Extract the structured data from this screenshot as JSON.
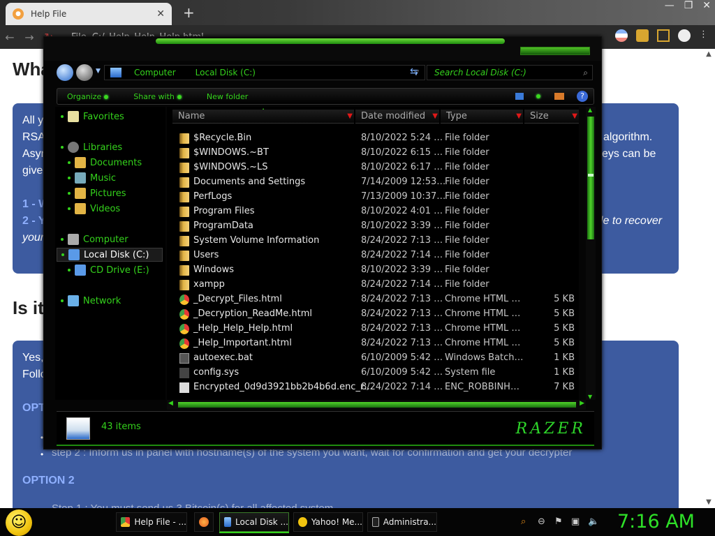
{
  "browser": {
    "tab_title": "Help File",
    "tab_close": "✕",
    "new_tab": "+",
    "window_controls": [
      "—",
      "❐",
      "✕"
    ],
    "url_prefix": "File",
    "url": "C:/_Help_Help_Help.html"
  },
  "page": {
    "heading1": "Wha",
    "heading2": "Is it",
    "box1_lines": [
      "All y",
      "RSA",
      "Asyr",
      "give"
    ],
    "box1_right": [
      " algorithm.",
      "eys can be"
    ],
    "box1_items": [
      "1 - W",
      "2 - Y"
    ],
    "box1_italic_right": "le to recover",
    "box1_italic_left": "your",
    "box2_lines": [
      "Yes,",
      "Follo"
    ],
    "option1": "OPTI",
    "step2_text": "step 2 : Inform us in panel with hostname(s) of the system you want, wait for confirmation and get your decrypter",
    "option2": "OPTION 2",
    "step1_text": "Step 1 : You must send us 3 Bitcoin(s) for all affected system"
  },
  "explorer": {
    "address": [
      "Computer",
      "Local Disk (C:)"
    ],
    "search_placeholder": "Search Local Disk (C:)",
    "commands": [
      "Organize",
      "Share with",
      "New folder"
    ],
    "nav": [
      {
        "label": "Favorites",
        "indent": 0,
        "icon": "star-icon"
      },
      {
        "label": "Libraries",
        "indent": 0,
        "icon": "libraries-icon"
      },
      {
        "label": "Documents",
        "indent": 1,
        "icon": "documents-icon"
      },
      {
        "label": "Music",
        "indent": 1,
        "icon": "music-icon"
      },
      {
        "label": "Pictures",
        "indent": 1,
        "icon": "pictures-icon"
      },
      {
        "label": "Videos",
        "indent": 1,
        "icon": "videos-icon"
      },
      {
        "label": "Computer",
        "indent": 0,
        "icon": "computer-icon"
      },
      {
        "label": "Local Disk (C:)",
        "indent": 1,
        "icon": "drive-icon",
        "selected": true
      },
      {
        "label": "CD Drive (E:)",
        "indent": 1,
        "icon": "cd-drive-icon"
      },
      {
        "label": "Network",
        "indent": 0,
        "icon": "network-icon"
      }
    ],
    "columns": [
      "Name",
      "Date modified",
      "Type",
      "Size"
    ],
    "files": [
      {
        "name": "$Recycle.Bin",
        "date": "8/10/2022 5:24 …",
        "type": "File folder",
        "size": "",
        "icon": "folder"
      },
      {
        "name": "$WINDOWS.~BT",
        "date": "8/10/2022 6:15 …",
        "type": "File folder",
        "size": "",
        "icon": "folder"
      },
      {
        "name": "$WINDOWS.~LS",
        "date": "8/10/2022 6:17 …",
        "type": "File folder",
        "size": "",
        "icon": "folder"
      },
      {
        "name": "Documents and Settings",
        "date": "7/14/2009 12:53…",
        "type": "File folder",
        "size": "",
        "icon": "folder"
      },
      {
        "name": "PerfLogs",
        "date": "7/13/2009 10:37…",
        "type": "File folder",
        "size": "",
        "icon": "folder"
      },
      {
        "name": "Program Files",
        "date": "8/10/2022 4:01 …",
        "type": "File folder",
        "size": "",
        "icon": "folder"
      },
      {
        "name": "ProgramData",
        "date": "8/10/2022 3:39 …",
        "type": "File folder",
        "size": "",
        "icon": "folder"
      },
      {
        "name": "System Volume Information",
        "date": "8/24/2022 7:13 …",
        "type": "File folder",
        "size": "",
        "icon": "folder"
      },
      {
        "name": "Users",
        "date": "8/24/2022 7:14 …",
        "type": "File folder",
        "size": "",
        "icon": "folder"
      },
      {
        "name": "Windows",
        "date": "8/10/2022 3:39 …",
        "type": "File folder",
        "size": "",
        "icon": "folder"
      },
      {
        "name": "xampp",
        "date": "8/24/2022 7:14 …",
        "type": "File folder",
        "size": "",
        "icon": "folder"
      },
      {
        "name": "_Decrypt_Files.html",
        "date": "8/24/2022 7:13 …",
        "type": "Chrome HTML …",
        "size": "5 KB",
        "icon": "chrome"
      },
      {
        "name": "_Decryption_ReadMe.html",
        "date": "8/24/2022 7:13 …",
        "type": "Chrome HTML …",
        "size": "5 KB",
        "icon": "chrome"
      },
      {
        "name": "_Help_Help_Help.html",
        "date": "8/24/2022 7:13 …",
        "type": "Chrome HTML …",
        "size": "5 KB",
        "icon": "chrome"
      },
      {
        "name": "_Help_Important.html",
        "date": "8/24/2022 7:13 …",
        "type": "Chrome HTML …",
        "size": "5 KB",
        "icon": "chrome"
      },
      {
        "name": "autoexec.bat",
        "date": "6/10/2009 5:42 …",
        "type": "Windows Batch…",
        "size": "1 KB",
        "icon": "bat"
      },
      {
        "name": "config.sys",
        "date": "6/10/2009 5:42 …",
        "type": "System file",
        "size": "1 KB",
        "icon": "sys"
      },
      {
        "name": "Encrypted_0d9d3921bb2b4b6d.enc_r…",
        "date": "8/24/2022 7:14 …",
        "type": "ENC_ROBBINH…",
        "size": "7 KB",
        "icon": "doc"
      }
    ],
    "status_count": "43 items",
    "brand": "RAZER"
  },
  "taskbar": {
    "buttons": [
      "Help File - ...",
      "Local Disk ...",
      "Yahoo! Me...",
      "Administra..."
    ],
    "clock": "7:16 AM"
  }
}
